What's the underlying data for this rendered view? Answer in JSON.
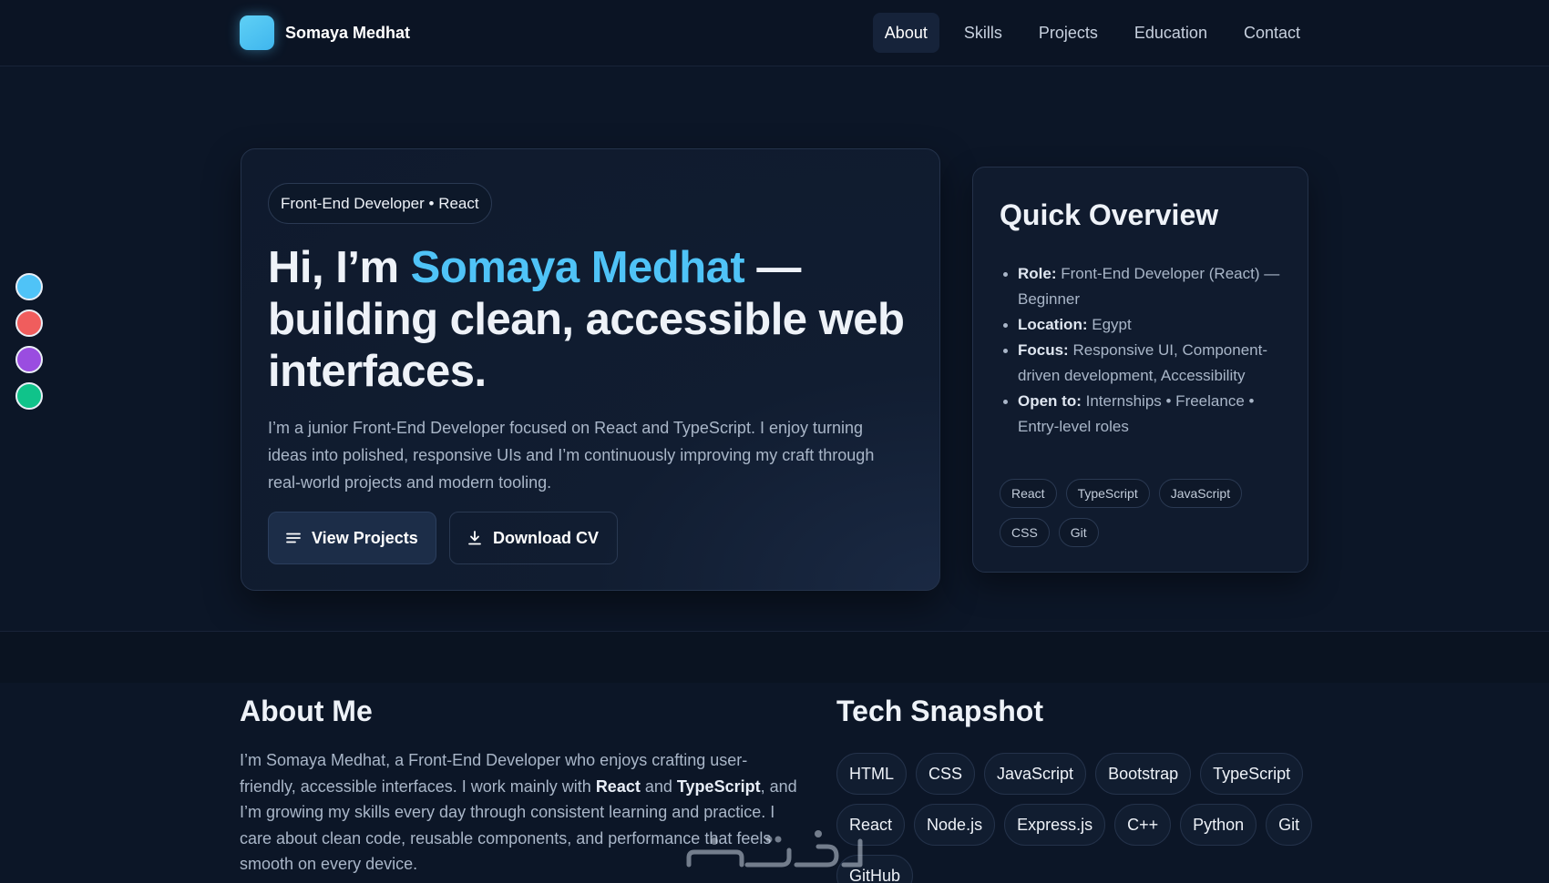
{
  "header": {
    "brand_name": "Somaya Medhat",
    "nav": [
      {
        "label": "About",
        "active": true
      },
      {
        "label": "Skills",
        "active": false
      },
      {
        "label": "Projects",
        "active": false
      },
      {
        "label": "Education",
        "active": false
      },
      {
        "label": "Contact",
        "active": false
      }
    ]
  },
  "theme_colors": [
    "#4fc3f7",
    "#f05d5d",
    "#9a4de0",
    "#10c38a"
  ],
  "hero": {
    "badge": "Front-End Developer • React",
    "title_pre": "Hi, I’m ",
    "title_name": "Somaya Medhat",
    "title_post": " — building clean, accessible web interfaces.",
    "description": "I’m a junior Front-End Developer focused on React and TypeScript. I enjoy turning ideas into polished, responsive UIs and I’m continuously improving my craft through real-world projects and modern tooling.",
    "primary_button": "View Projects",
    "secondary_button": "Download CV"
  },
  "overview": {
    "title": "Quick Overview",
    "items": [
      {
        "label": "Role:",
        "value": "Front-End Developer (React) — Beginner"
      },
      {
        "label": "Location:",
        "value": "Egypt"
      },
      {
        "label": "Focus:",
        "value": "Responsive UI, Component-driven development, Accessibility"
      },
      {
        "label": "Open to:",
        "value": "Internships • Freelance • Entry-level roles"
      }
    ],
    "tags": [
      "React",
      "TypeScript",
      "JavaScript",
      "CSS",
      "Git"
    ]
  },
  "about": {
    "title": "About Me",
    "text_1": "I’m Somaya Medhat, a Front-End Developer who enjoys crafting user-friendly, accessible interfaces. I work mainly with ",
    "bold_1": "React",
    "text_2": " and ",
    "bold_2": "TypeScript",
    "text_3": ", and I’m growing my skills every day through consistent learning and practice. I care about clean code, reusable components, and performance that feels smooth on every device."
  },
  "tech": {
    "title": "Tech Snapshot",
    "items": [
      "HTML",
      "CSS",
      "JavaScript",
      "Bootstrap",
      "TypeScript",
      "React",
      "Node.js",
      "Express.js",
      "C++",
      "Python",
      "Git",
      "GitHub"
    ]
  },
  "colors": {
    "accent": "#4fc3f7",
    "background": "#0c1627"
  }
}
